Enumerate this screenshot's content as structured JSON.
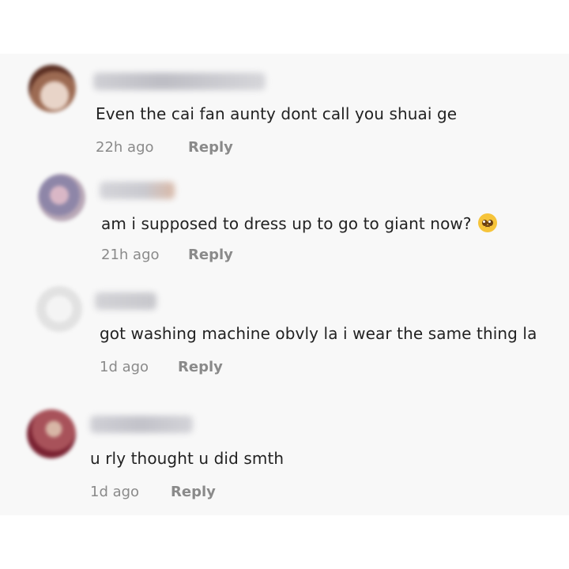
{
  "comments": [
    {
      "text": "Even the cai fan aunty dont call you shuai ge",
      "time": "22h ago",
      "reply": "Reply",
      "emoji": ""
    },
    {
      "text": "am i supposed to dress up to go to giant now?",
      "time": "21h ago",
      "reply": "Reply",
      "emoji": "pleading-face-icon"
    },
    {
      "text": "got washing machine obvly la i wear the same thing la",
      "time": "1d ago",
      "reply": "Reply",
      "emoji": ""
    },
    {
      "text": "u rly thought u did smth",
      "time": "1d ago",
      "reply": "Reply",
      "emoji": ""
    }
  ],
  "colors": {
    "panel_bg": "#f8f8f8",
    "text": "#222222",
    "meta": "#8a8a8a"
  }
}
